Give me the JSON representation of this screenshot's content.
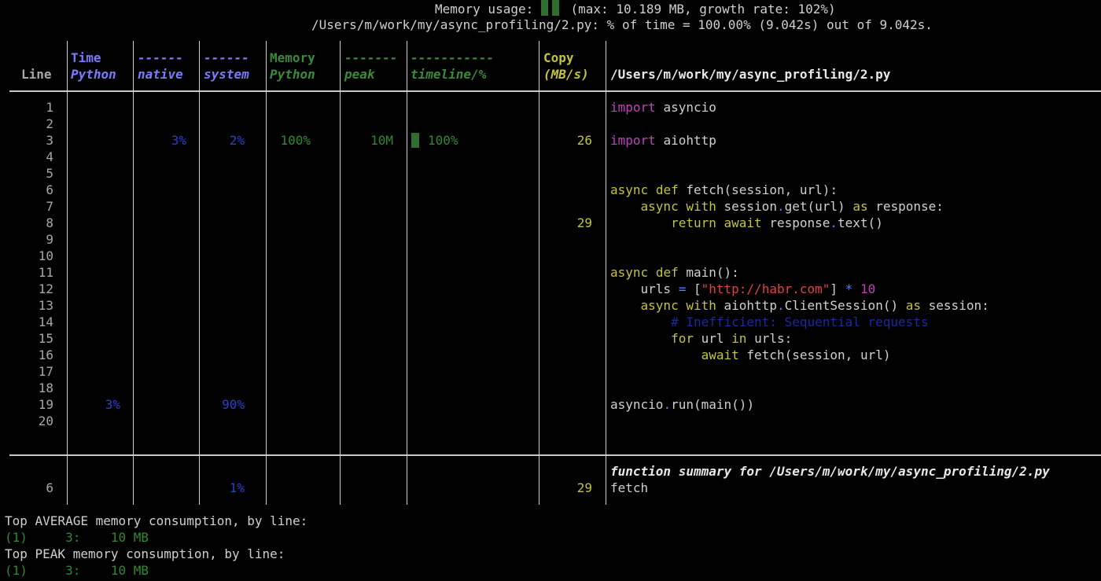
{
  "header": {
    "memory_prefix": "Memory usage:",
    "memory_suffix": "(max: 10.189 MB, growth rate: 102%)",
    "summary_line": "/Users/m/work/my/async_profiling/2.py: % of time = 100.00% (9.042s) out of 9.042s."
  },
  "columns": {
    "line": "Line",
    "time_python_top": "Time",
    "time_python_bottom": "Python",
    "native_top": "------",
    "native_bottom": "native",
    "system_top": "------",
    "system_bottom": "system",
    "mem_python_top": "Memory",
    "mem_python_bottom": "Python",
    "peak_top": "-------",
    "peak_bottom": "peak",
    "timeline_top": "-----------",
    "timeline_bottom": "timeline/%",
    "copy_top": "Copy",
    "copy_bottom": "(MB/s)",
    "file": "/Users/m/work/my/async_profiling/2.py"
  },
  "rows": [
    {
      "n": "1",
      "code": "import asyncio"
    },
    {
      "n": "2",
      "code": ""
    },
    {
      "n": "3",
      "native": "3%",
      "system": "2%",
      "mem_python": "100%",
      "peak": "10M",
      "timeline": "100%",
      "copy": "26",
      "code": "import aiohttp"
    },
    {
      "n": "4",
      "code": ""
    },
    {
      "n": "5",
      "code": ""
    },
    {
      "n": "6",
      "code": "async def fetch(session, url):"
    },
    {
      "n": "7",
      "code": "    async with session.get(url) as response:"
    },
    {
      "n": "8",
      "copy": "29",
      "code": "        return await response.text()"
    },
    {
      "n": "9",
      "code": ""
    },
    {
      "n": "10",
      "code": ""
    },
    {
      "n": "11",
      "code": "async def main():"
    },
    {
      "n": "12",
      "code": "    urls = [\"http://habr.com\"] * 10"
    },
    {
      "n": "13",
      "code": "    async with aiohttp.ClientSession() as session:"
    },
    {
      "n": "14",
      "code": "        # Inefficient: Sequential requests"
    },
    {
      "n": "15",
      "code": "        for url in urls:"
    },
    {
      "n": "16",
      "code": "            await fetch(session, url)"
    },
    {
      "n": "17",
      "code": ""
    },
    {
      "n": "18",
      "code": ""
    },
    {
      "n": "19",
      "time_python": "3%",
      "system": "90%",
      "code": "asyncio.run(main())"
    },
    {
      "n": "20",
      "code": ""
    }
  ],
  "function_summary": {
    "title": "function summary for /Users/m/work/my/async_profiling/2.py",
    "n": "6",
    "system": "1%",
    "copy": "29",
    "name": "fetch"
  },
  "footer": {
    "avg_title": "Top AVERAGE memory consumption, by line:",
    "avg_entry": "(1)     3:    10 MB",
    "peak_title": "Top PEAK memory consumption, by line:",
    "peak_entry": "(1)     3:    10 MB"
  },
  "colors": {
    "background": "#000000",
    "time_header": "#7a7aff",
    "native_system_values": "#2a3fd6",
    "memory_values": "#2f8a2f",
    "copy_values": "#c4c43a",
    "memory_bar": "#2f6e2f"
  }
}
